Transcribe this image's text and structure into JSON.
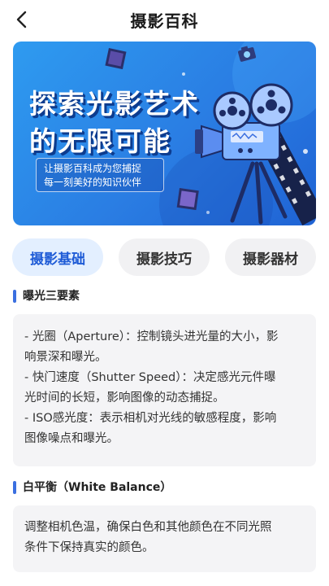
{
  "header": {
    "title": "摄影百科"
  },
  "banner": {
    "headline_line1": "探索光影艺术",
    "headline_line2": "的无限可能",
    "subtitle_line1": "让摄影百科成为您捕捉",
    "subtitle_line2": "每一刻美好的知识伙伴"
  },
  "tabs": [
    {
      "label": "摄影基础",
      "active": true
    },
    {
      "label": "摄影技巧",
      "active": false
    },
    {
      "label": "摄影器材",
      "active": false
    }
  ],
  "sections": [
    {
      "title": "曝光三要素",
      "lines": [
        "- 光圈（Aperture）：控制镜头进光量的大小，影",
        "响景深和曝光。",
        "- 快门速度（Shutter Speed）：决定感光元件曝",
        "光时间的长短，影响图像的动态捕捉。",
        "- ISO感光度：表示相机对光线的敏感程度，影响",
        "图像噪点和曝光。"
      ]
    },
    {
      "title": "白平衡（White Balance）",
      "lines": [
        "调整相机色温，确保白色和其他颜色在不同光照",
        "条件下保持真实的颜色。"
      ]
    }
  ],
  "colors": {
    "accent": "#1e5bd6",
    "tab_active_bg": "#e3efff",
    "banner": "#2a7de3"
  },
  "icons": {
    "back": "chevron-left-icon",
    "illustration": "film-projector-illustration"
  }
}
